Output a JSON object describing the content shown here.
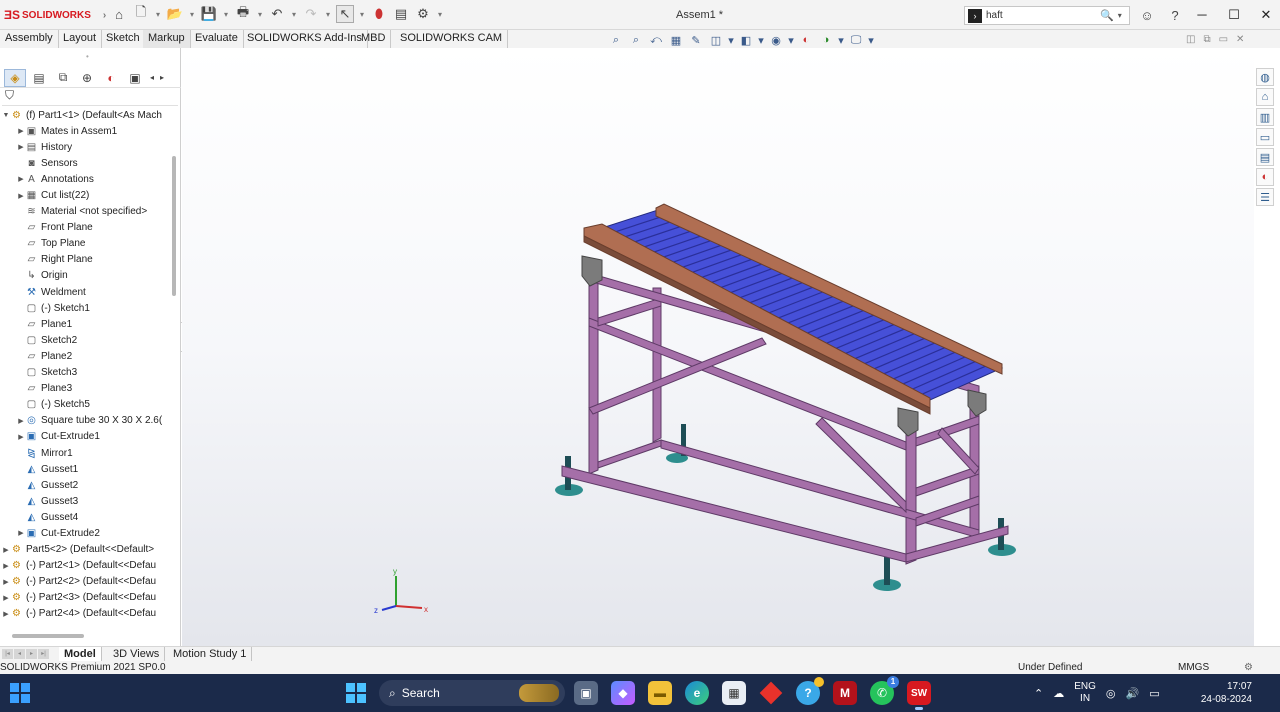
{
  "app": {
    "logo_text": "SOLIDWORKS",
    "document_title": "Assem1 *",
    "search_value": "haft",
    "search_placeholder": ""
  },
  "title_toolbar": {
    "icons": [
      "home-icon",
      "new-document-icon",
      "open-icon",
      "save-icon",
      "print-icon",
      "undo-icon",
      "redo-icon",
      "select-icon",
      "rebuild-icon",
      "file-properties-icon",
      "options-icon"
    ]
  },
  "command_tabs": [
    {
      "label": "Assembly",
      "active": false
    },
    {
      "label": "Layout",
      "active": false
    },
    {
      "label": "Sketch",
      "active": false
    },
    {
      "label": "Markup",
      "active": true
    },
    {
      "label": "Evaluate",
      "active": false
    },
    {
      "label": "SOLIDWORKS Add-Ins",
      "active": false
    },
    {
      "label": "MBD",
      "active": false
    },
    {
      "label": "SOLIDWORKS CAM",
      "active": false
    }
  ],
  "feature_tree": [
    {
      "label": "(f) Part1<1> (Default<As Mach",
      "icon": "component-icon",
      "level": 0,
      "arrow": "▼"
    },
    {
      "label": "Mates in Assem1",
      "icon": "mates-folder-icon",
      "level": 1,
      "arrow": "▶"
    },
    {
      "label": "History",
      "icon": "history-folder-icon",
      "level": 1,
      "arrow": "▶"
    },
    {
      "label": "Sensors",
      "icon": "sensors-icon",
      "level": 1,
      "arrow": ""
    },
    {
      "label": "Annotations",
      "icon": "annotations-folder-icon",
      "level": 1,
      "arrow": "▶"
    },
    {
      "label": "Cut list(22)",
      "icon": "cut-list-icon",
      "level": 1,
      "arrow": "▶"
    },
    {
      "label": "Material <not specified>",
      "icon": "material-icon",
      "level": 1,
      "arrow": ""
    },
    {
      "label": "Front Plane",
      "icon": "plane-icon",
      "level": 1,
      "arrow": ""
    },
    {
      "label": "Top Plane",
      "icon": "plane-icon",
      "level": 1,
      "arrow": ""
    },
    {
      "label": "Right Plane",
      "icon": "plane-icon",
      "level": 1,
      "arrow": ""
    },
    {
      "label": "Origin",
      "icon": "origin-icon",
      "level": 1,
      "arrow": ""
    },
    {
      "label": "Weldment",
      "icon": "weldment-icon",
      "level": 1,
      "arrow": ""
    },
    {
      "label": "(-) Sketch1",
      "icon": "sketch-icon",
      "level": 1,
      "arrow": ""
    },
    {
      "label": "Plane1",
      "icon": "plane-icon",
      "level": 1,
      "arrow": ""
    },
    {
      "label": "Sketch2",
      "icon": "sketch-icon",
      "level": 1,
      "arrow": ""
    },
    {
      "label": "Plane2",
      "icon": "plane-icon",
      "level": 1,
      "arrow": ""
    },
    {
      "label": "Sketch3",
      "icon": "sketch-icon",
      "level": 1,
      "arrow": ""
    },
    {
      "label": "Plane3",
      "icon": "plane-icon",
      "level": 1,
      "arrow": ""
    },
    {
      "label": "(-) Sketch5",
      "icon": "sketch-icon",
      "level": 1,
      "arrow": ""
    },
    {
      "label": "Square tube 30 X 30 X 2.6(",
      "icon": "structural-member-icon",
      "level": 1,
      "arrow": "▶"
    },
    {
      "label": "Cut-Extrude1",
      "icon": "cut-extrude-icon",
      "level": 1,
      "arrow": "▶"
    },
    {
      "label": "Mirror1",
      "icon": "mirror-icon",
      "level": 1,
      "arrow": ""
    },
    {
      "label": "Gusset1",
      "icon": "gusset-icon",
      "level": 1,
      "arrow": ""
    },
    {
      "label": "Gusset2",
      "icon": "gusset-icon",
      "level": 1,
      "arrow": ""
    },
    {
      "label": "Gusset3",
      "icon": "gusset-icon",
      "level": 1,
      "arrow": ""
    },
    {
      "label": "Gusset4",
      "icon": "gusset-icon",
      "level": 1,
      "arrow": ""
    },
    {
      "label": "Cut-Extrude2",
      "icon": "cut-extrude-icon",
      "level": 1,
      "arrow": "▶"
    },
    {
      "label": "Part5<2> (Default<<Default>",
      "icon": "component-icon",
      "level": 0,
      "arrow": "▶"
    },
    {
      "label": "(-) Part2<1> (Default<<Defau",
      "icon": "component-icon",
      "level": 0,
      "arrow": "▶"
    },
    {
      "label": "(-) Part2<2> (Default<<Defau",
      "icon": "component-icon",
      "level": 0,
      "arrow": "▶"
    },
    {
      "label": "(-) Part2<3> (Default<<Defau",
      "icon": "component-icon",
      "level": 0,
      "arrow": "▶"
    },
    {
      "label": "(-) Part2<4> (Default<<Defau",
      "icon": "component-icon",
      "level": 0,
      "arrow": "▶"
    }
  ],
  "bottom_tabs": [
    {
      "label": "Model",
      "active": true
    },
    {
      "label": "3D Views",
      "active": false
    },
    {
      "label": "Motion Study 1",
      "active": false
    }
  ],
  "status": {
    "product": "SOLIDWORKS Premium 2021 SP0.0",
    "state": "Under Defined",
    "units": "MMGS"
  },
  "triad": {
    "x": "x",
    "y": "y",
    "z": "z"
  },
  "taskbar": {
    "search_label": "Search",
    "lang_line1": "ENG",
    "lang_line2": "IN",
    "time": "17:07",
    "date": "24-08-2024",
    "notification_count": "1"
  },
  "colors": {
    "frame": "#a56fa8",
    "rollers": "#4650d8",
    "side_rails": "#b06e52",
    "feet": "#2e8e8e",
    "brackets": "#7b7b7b",
    "accent": "#d71920"
  }
}
